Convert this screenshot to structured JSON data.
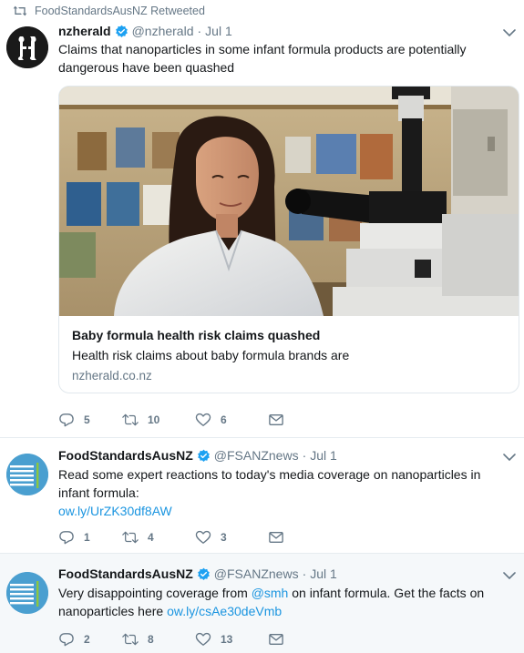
{
  "tweets": [
    {
      "retweeted_by": "FoodStandardsAusNZ Retweeted",
      "name": "nzherald",
      "handle": "@nzherald",
      "date": "Jul 1",
      "text": "Claims that nanoparticles in some infant formula products are potentially dangerous have been quashed",
      "card": {
        "title": "Baby formula health risk claims quashed",
        "description": "Health risk claims about baby formula brands are",
        "domain": "nzherald.co.nz"
      },
      "replies": "5",
      "retweets": "10",
      "likes": "6"
    },
    {
      "name": "FoodStandardsAusNZ",
      "handle": "@FSANZnews",
      "date": "Jul 1",
      "text": "Read some expert reactions to today's media coverage on nanoparticles in infant formula:",
      "link": "ow.ly/UrZK30df8AW",
      "replies": "1",
      "retweets": "4",
      "likes": "3"
    },
    {
      "name": "FoodStandardsAusNZ",
      "handle": "@FSANZnews",
      "date": "Jul 1",
      "text_before": "Very disappointing coverage from ",
      "mention": "@smh",
      "text_after": " on infant formula. Get the facts on nanoparticles here ",
      "link": "ow.ly/csAe30deVmb",
      "replies": "2",
      "retweets": "8",
      "likes": "13"
    }
  ],
  "colors": {
    "accent": "#1b95e0",
    "muted": "#657786",
    "text": "#14171a",
    "verified": "#1da1f2"
  },
  "icons": [
    "retweet-icon",
    "verified-icon",
    "chevron-down-icon",
    "reply-icon",
    "like-icon",
    "direct-message-icon"
  ]
}
